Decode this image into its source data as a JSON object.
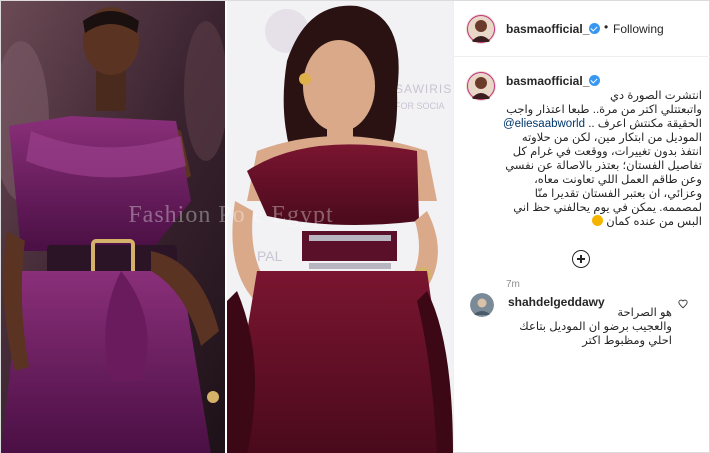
{
  "post": {
    "author": {
      "username": "basmaofficial_",
      "verified": true,
      "follow_label": "Following",
      "separator": "•"
    },
    "media": {
      "watermark": "Fashion Po  e Egypt",
      "left_image": "model in plum one-shoulder gown",
      "right_image": "woman in burgundy velvet one-shoulder gown on red carpet"
    },
    "caption": {
      "username": "basmaofficial_",
      "lines": [
        "انتشرت الصورة دي",
        "واتبعتتلي اكتر من مرة.. طبعا اعتذار واجب",
        "الحقيقة مكنتش اعرف ..",
        "الموديل من ابتكار مين، لكن من حلاوته",
        "انتفذ بدون تغييرات، ووقعت في غرام كل",
        "تفاصيل الفستان؛ بعتذر بالاصالة عن نفسي",
        "وعن طاقم العمل اللي تعاونت معاه،",
        "وعزائي، ان بعتبر الفستان تقديرا منّا",
        "لمصممه. يمكن في يوم يحالفني حظ اني",
        "البس من عنده كمان"
      ],
      "mention": "@eliesaabworld",
      "timestamp": "7m"
    },
    "comments": [
      {
        "username": "shahdelgeddawy",
        "lines": [
          "هو الصراحة",
          "والعجيب برضو ان الموديل بتاعك",
          "احلي ومظبوط اكتر"
        ]
      }
    ]
  },
  "icons": {
    "verified": "verified-badge-icon",
    "load_more": "plus-circle-icon",
    "like": "heart-icon",
    "emoji": "heart-eyes-emoji-icon"
  },
  "colors": {
    "verified": "#3897f0",
    "mention": "#00376b",
    "timestamp": "#8e8e8e",
    "border": "#dbdbdb"
  }
}
